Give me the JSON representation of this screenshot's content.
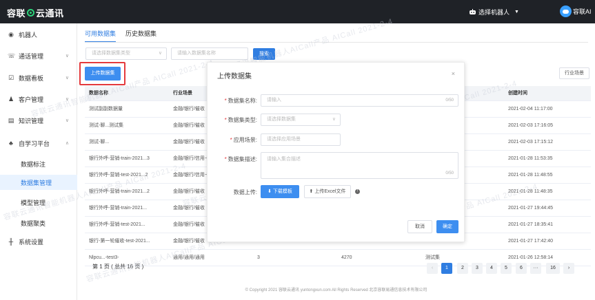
{
  "app": {
    "logo": "容联",
    "logo_tail": "云通讯"
  },
  "header": {
    "robot_select": "选择机器人",
    "user_name": "容联AI"
  },
  "sidebar": {
    "items": [
      {
        "label": "机器人",
        "icon": "robot-icon"
      },
      {
        "label": "通话管理",
        "icon": "phone-icon"
      },
      {
        "label": "数据看板",
        "icon": "dashboard-icon"
      },
      {
        "label": "客户管理",
        "icon": "users-icon"
      },
      {
        "label": "知识管理",
        "icon": "book-icon"
      },
      {
        "label": "自学习平台",
        "icon": "learning-icon"
      },
      {
        "label": "系统设置",
        "icon": "settings-icon"
      }
    ],
    "sub_items": [
      "数据标注",
      "数据集管理",
      "模型管理",
      "数据聚类"
    ]
  },
  "tabs": [
    "可用数据集",
    "历史数据集"
  ],
  "filters": {
    "type_placeholder": "请选择数据集类型",
    "name_placeholder": "请输入数据集名称",
    "search_label": "搜索"
  },
  "actions": {
    "upload_label": "上传数据集",
    "scene_label": "行业场景"
  },
  "table": {
    "headers": [
      "数据名称",
      "行业场景",
      "",
      "",
      "",
      "创建时间"
    ],
    "rows": [
      [
        "测试副副数据量",
        "金融/银行/催收",
        "",
        "",
        "",
        "2021-02-04 11:17:00"
      ],
      [
        "测试-聊...测试集",
        "金融/银行/催收",
        "",
        "",
        "",
        "2021-02-03 17:16:05"
      ],
      [
        "测试-聊...",
        "金融/银行/催收",
        "",
        "",
        "",
        "2021-02-03 17:15:12"
      ],
      [
        "银行外呼-营销-train-2021...3",
        "金融/银行/信用卡",
        "",
        "",
        "",
        "2021-01-28 11:53:35"
      ],
      [
        "银行外呼-营销-test-2021...2",
        "金融/银行/信用卡",
        "",
        "",
        "",
        "2021-01-28 11:48:55"
      ],
      [
        "银行外呼-营销-train-2021...2",
        "金融/银行/催收",
        "",
        "",
        "",
        "2021-01-28 11:48:35"
      ],
      [
        "银行外呼-营销-train-2021...",
        "金融/银行/催收",
        "",
        "",
        "",
        "2021-01-27 19:44:45"
      ],
      [
        "银行外呼-营销-test-2021...",
        "金融/银行/催收",
        "",
        "",
        "",
        "2021-01-27 18:35:41"
      ],
      [
        "银行-第一轮催收-test-2021...",
        "金融/银行/催收",
        "",
        "",
        "",
        "2021-01-27 17:42:40"
      ],
      [
        "Nlpcu...-test3-",
        "通用/通用/通用",
        "3",
        "4270",
        "测试集",
        "2021-01-26 12:58:14"
      ]
    ]
  },
  "pagination": {
    "info": "第 1 页 ( 总共 16 页 )",
    "prev": "‹",
    "pages": [
      "1",
      "2",
      "3",
      "4",
      "5",
      "6",
      "···",
      "16"
    ],
    "next": "›"
  },
  "footer": {
    "text": "© Copyright 2021   容联云通讯   yuntongxun.com   All Rights Reserved  北京容联易通信息技术有限公司"
  },
  "modal": {
    "title": "上传数据集",
    "close": "×",
    "name_label": "数据集名称:",
    "name_placeholder": "请输入",
    "name_count": "0/50",
    "type_label": "数据集类型:",
    "type_placeholder": "请选择数据集",
    "scene_label": "应用场景:",
    "scene_placeholder": "请选择应用场景",
    "desc_label": "数据集描述:",
    "desc_placeholder": "请输入集合描述",
    "desc_count": "0/50",
    "upload_label": "数据上传:",
    "download_btn": "下载模板",
    "upload_btn": "上传Excel文件",
    "cancel_label": "取消",
    "ok_label": "确定"
  },
  "watermark": {
    "text": "容联云通讯智能机器人AICall产品  AICall  2021-2-4"
  }
}
